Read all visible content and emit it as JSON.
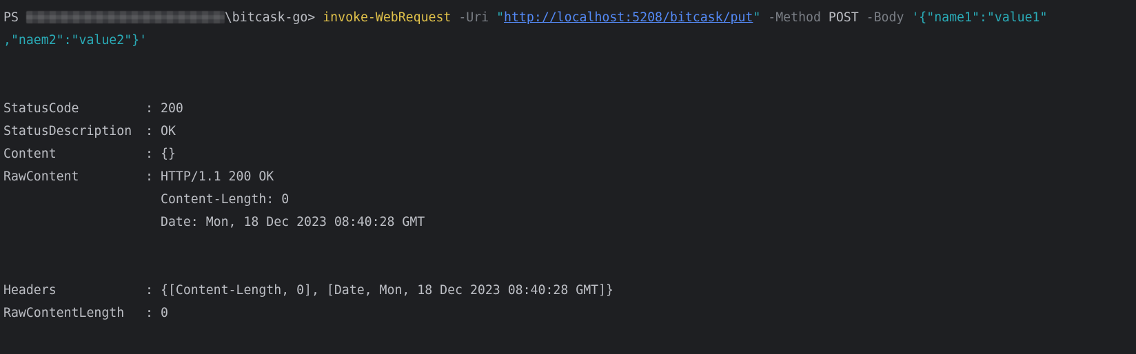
{
  "prompt": {
    "prefix": "PS ",
    "path_tail": "\\bitcask-go> ",
    "command": "invoke-WebRequest",
    "uri_flag": " -Uri ",
    "quote_open": "\"",
    "url": "http://localhost:5208/bitcask/put",
    "quote_close": "\"",
    "method_flag": " -Method ",
    "method_value": "POST",
    "body_flag": " -Body ",
    "body_part1": "'{\"name1\":\"value1\"",
    "body_part2": ",\"naem2\":\"value2\"}'"
  },
  "output": {
    "separator": ": ",
    "status_code": {
      "key": "StatusCode",
      "value": "200"
    },
    "status_description": {
      "key": "StatusDescription",
      "value": "OK"
    },
    "content": {
      "key": "Content",
      "value": "{}"
    },
    "raw_content": {
      "key": "RawContent",
      "lines": [
        "HTTP/1.1 200 OK",
        "Content-Length: 0",
        "Date: Mon, 18 Dec 2023 08:40:28 GMT"
      ]
    },
    "headers": {
      "key": "Headers",
      "value": "{[Content-Length, 0], [Date, Mon, 18 Dec 2023 08:40:28 GMT]}"
    },
    "raw_content_length": {
      "key": "RawContentLength",
      "value": "0"
    }
  }
}
